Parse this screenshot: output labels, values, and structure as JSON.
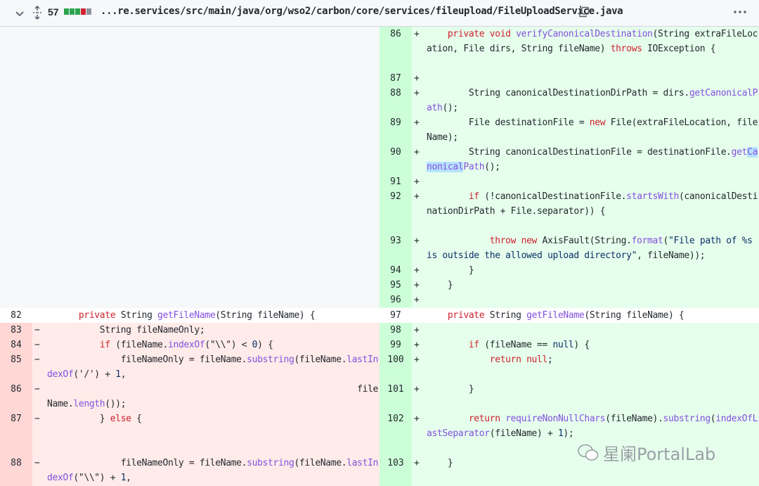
{
  "header": {
    "changes_count": "57",
    "diffstat": [
      "#2da44e",
      "#2da44e",
      "#2da44e",
      "#cf222e",
      "#8c959f"
    ],
    "file_path": "...re.services/src/main/java/org/wso2/carbon/core/services/fileupload/FileUploadService.java",
    "icons": {
      "collapse": "chevron-down-icon",
      "expand": "unfold-icon",
      "copy": "copy-icon",
      "more": "kebab-horizontal-icon"
    }
  },
  "colors": {
    "added_bg": "#e6ffec",
    "added_num_bg": "#ccffd8",
    "deleted_bg": "#ffebe9",
    "deleted_num_bg": "#ffd7d5",
    "keyword": "#cf222e",
    "method": "#8250df"
  },
  "left": [
    {
      "num": "",
      "mark": "",
      "code": []
    },
    {
      "num": "82",
      "mark": "",
      "code": [
        [
          "      ",
          ""
        ],
        [
          "private",
          "kw"
        ],
        [
          " String ",
          ""
        ],
        [
          "getFileName",
          "fn"
        ],
        [
          "(String fileName) {",
          ""
        ]
      ]
    },
    {
      "num": "83",
      "mark": "−",
      "code": [
        [
          "          String fileNameOnly;",
          ""
        ]
      ]
    },
    {
      "num": "84",
      "mark": "−",
      "code": [
        [
          "          ",
          ""
        ],
        [
          "if",
          "kw"
        ],
        [
          " (fileName.",
          ""
        ],
        [
          "indexOf",
          "fn"
        ],
        [
          "(\"\\\\\") < ",
          ""
        ],
        [
          "0",
          "str"
        ],
        [
          ") {",
          ""
        ]
      ]
    },
    {
      "num": "85",
      "mark": "−",
      "code": [
        [
          "              fileNameOnly = fileName.",
          ""
        ],
        [
          "substring",
          "fn"
        ],
        [
          "(fileName.",
          ""
        ],
        [
          "lastIndexOf",
          "fn"
        ],
        [
          "('/') + ",
          ""
        ],
        [
          "1",
          "str"
        ],
        [
          ",",
          ""
        ]
      ]
    },
    {
      "num": "86",
      "mark": "−",
      "code": [
        [
          "                                                           fileName.",
          ""
        ],
        [
          "length",
          "fn"
        ],
        [
          "());",
          ""
        ]
      ]
    },
    {
      "num": "87",
      "mark": "−",
      "code": [
        [
          "          } ",
          ""
        ],
        [
          "else",
          "kw"
        ],
        [
          " {",
          ""
        ]
      ]
    },
    {
      "num": "88",
      "mark": "−",
      "code": [
        [
          "              fileNameOnly = fileName.",
          ""
        ],
        [
          "substring",
          "fn"
        ],
        [
          "(fileName.",
          ""
        ],
        [
          "lastIndexOf",
          "fn"
        ],
        [
          "(\"\\\\\") + ",
          ""
        ],
        [
          "1",
          "str"
        ],
        [
          ",",
          ""
        ]
      ]
    }
  ],
  "right": [
    {
      "num": "86",
      "mark": "+",
      "code": [
        [
          "    ",
          ""
        ],
        [
          "private void",
          "kw"
        ],
        [
          " ",
          ""
        ],
        [
          "verifyCanonicalDestination",
          "fn"
        ],
        [
          "(String extraFileLocation, File dirs, String fileName) ",
          ""
        ],
        [
          "throws",
          "kw"
        ],
        [
          " IOException {",
          ""
        ]
      ]
    },
    {
      "num": "87",
      "mark": "+",
      "code": []
    },
    {
      "num": "88",
      "mark": "+",
      "code": [
        [
          "        String canonicalDestinationDirPath = dirs.",
          ""
        ],
        [
          "getCanonicalPath",
          "fn"
        ],
        [
          "();",
          ""
        ]
      ]
    },
    {
      "num": "89",
      "mark": "+",
      "code": [
        [
          "        File destinationFile = ",
          ""
        ],
        [
          "new",
          "kw"
        ],
        [
          " File(extraFileLocation, fileName);",
          ""
        ]
      ]
    },
    {
      "num": "90",
      "mark": "+",
      "code": [
        [
          "        String canonicalDestinationFile = destinationFile.",
          ""
        ],
        [
          "get",
          "fn"
        ],
        [
          "Canonical",
          "fn hl"
        ],
        [
          "Path",
          "fn"
        ],
        [
          "();",
          ""
        ]
      ]
    },
    {
      "num": "91",
      "mark": "+",
      "code": []
    },
    {
      "num": "92",
      "mark": "+",
      "code": [
        [
          "        ",
          ""
        ],
        [
          "if",
          "kw"
        ],
        [
          " (!canonicalDestinationFile.",
          ""
        ],
        [
          "startsWith",
          "fn"
        ],
        [
          "(canonicalDestinationDirPath + File.separator)) {",
          ""
        ]
      ]
    },
    {
      "num": "93",
      "mark": "+",
      "code": [
        [
          "            ",
          ""
        ],
        [
          "throw new",
          "kw"
        ],
        [
          " AxisFault(String.",
          ""
        ],
        [
          "format",
          "fn"
        ],
        [
          "(",
          ""
        ],
        [
          "\"File path of %s is outside the allowed upload directory\"",
          "str"
        ],
        [
          ", fileName));",
          ""
        ]
      ]
    },
    {
      "num": "94",
      "mark": "+",
      "code": [
        [
          "        }",
          ""
        ]
      ]
    },
    {
      "num": "95",
      "mark": "+",
      "code": [
        [
          "    }",
          ""
        ]
      ]
    },
    {
      "num": "96",
      "mark": "+",
      "code": []
    },
    {
      "num": "97",
      "mark": "",
      "code": [
        [
          "    ",
          ""
        ],
        [
          "private",
          "kw"
        ],
        [
          " String ",
          ""
        ],
        [
          "getFileName",
          "fn"
        ],
        [
          "(String fileName) {",
          ""
        ]
      ]
    },
    {
      "num": "98",
      "mark": "+",
      "code": []
    },
    {
      "num": "99",
      "mark": "+",
      "code": [
        [
          "        ",
          ""
        ],
        [
          "if",
          "kw"
        ],
        [
          " (fileName == ",
          ""
        ],
        [
          "null",
          "str"
        ],
        [
          ") {",
          ""
        ]
      ]
    },
    {
      "num": "100",
      "mark": "+",
      "code": [
        [
          "            ",
          ""
        ],
        [
          "return null",
          "kw"
        ],
        [
          ";",
          ""
        ]
      ]
    },
    {
      "num": "101",
      "mark": "+",
      "code": [
        [
          "        }",
          ""
        ]
      ]
    },
    {
      "num": "102",
      "mark": "+",
      "code": [
        [
          "        ",
          ""
        ],
        [
          "return",
          "kw"
        ],
        [
          " ",
          ""
        ],
        [
          "requireNonNullChars",
          "fn"
        ],
        [
          "(fileName).",
          ""
        ],
        [
          "substring",
          "fn"
        ],
        [
          "(",
          ""
        ],
        [
          "indexOfLastSeparator",
          "fn"
        ],
        [
          "(fileName) + ",
          ""
        ],
        [
          "1",
          "str"
        ],
        [
          ");",
          ""
        ]
      ]
    },
    {
      "num": "103",
      "mark": "+",
      "code": [
        [
          "    }",
          ""
        ]
      ]
    }
  ],
  "watermark": "星阑PortalLab"
}
